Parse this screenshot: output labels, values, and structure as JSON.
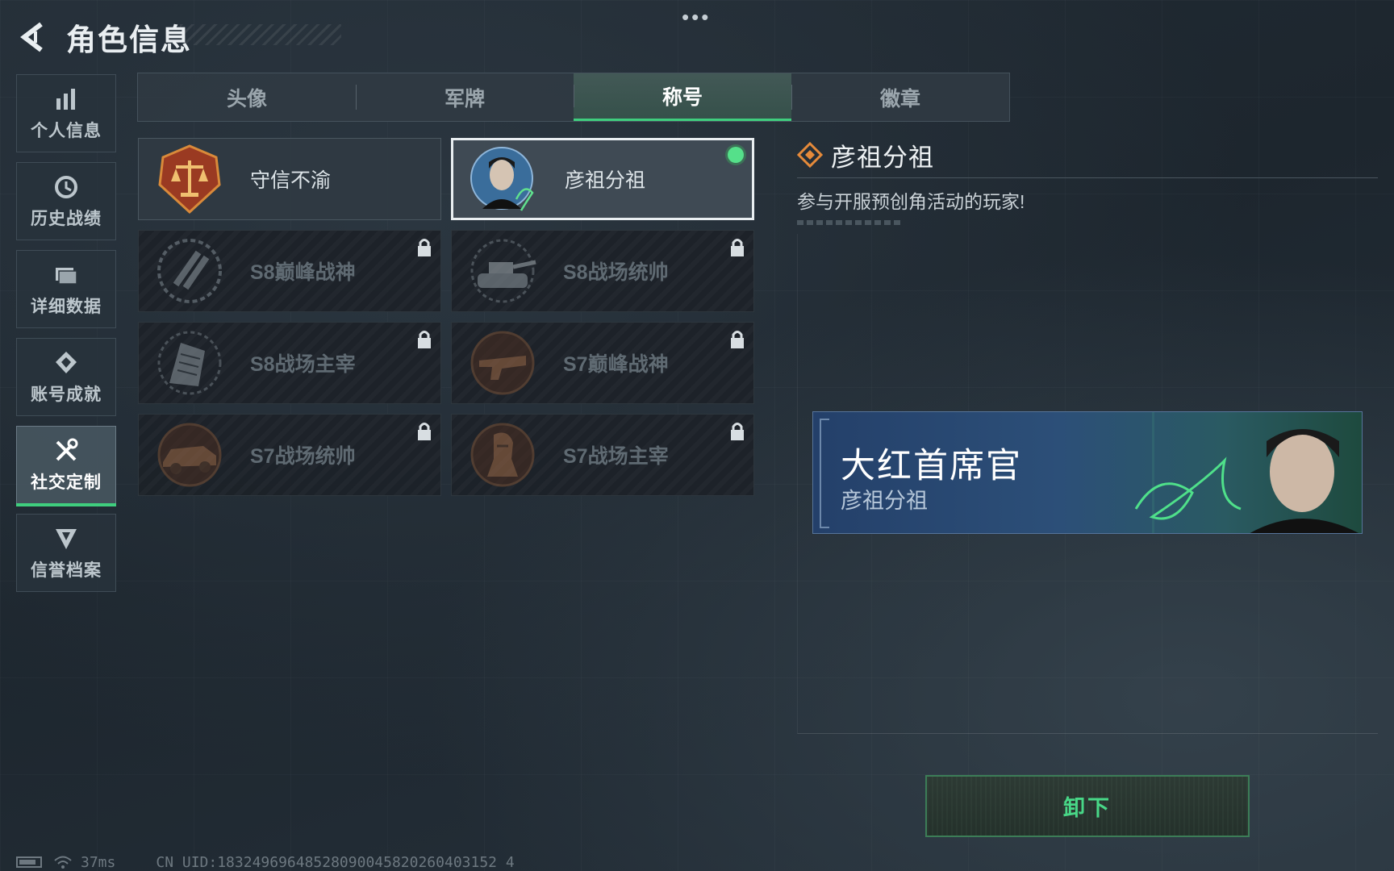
{
  "header": {
    "title": "角色信息",
    "more_label": "•••"
  },
  "sidebar": {
    "items": [
      {
        "label": "个人信息",
        "icon": "bar-chart-icon",
        "active": false
      },
      {
        "label": "历史战绩",
        "icon": "history-clock-icon",
        "active": false
      },
      {
        "label": "详细数据",
        "icon": "folder-icon",
        "active": false
      },
      {
        "label": "账号成就",
        "icon": "medal-icon",
        "active": false
      },
      {
        "label": "社交定制",
        "icon": "tools-icon",
        "active": true
      },
      {
        "label": "信誉档案",
        "icon": "shield-icon",
        "active": false
      }
    ]
  },
  "tabs": [
    {
      "label": "头像",
      "active": false
    },
    {
      "label": "军牌",
      "active": false
    },
    {
      "label": "称号",
      "active": true
    },
    {
      "label": "徽章",
      "active": false
    }
  ],
  "titles": [
    {
      "name": "守信不渝",
      "locked": false,
      "equipped": false,
      "icon": "scales-emblem-icon"
    },
    {
      "name": "彦祖分祖",
      "locked": false,
      "equipped": true,
      "icon": "portrait-emblem-icon"
    },
    {
      "name": "S8巅峰战神",
      "locked": true,
      "equipped": false,
      "icon": "slash-emblem-icon"
    },
    {
      "name": "S8战场统帅",
      "locked": true,
      "equipped": false,
      "icon": "tank-emblem-icon"
    },
    {
      "name": "S8战场主宰",
      "locked": true,
      "equipped": false,
      "icon": "building-emblem-icon"
    },
    {
      "name": "S7巅峰战神",
      "locked": true,
      "equipped": false,
      "icon": "weapon-emblem-icon"
    },
    {
      "name": "S7战场统帅",
      "locked": true,
      "equipped": false,
      "icon": "vehicle-emblem-icon"
    },
    {
      "name": "S7战场主宰",
      "locked": true,
      "equipped": false,
      "icon": "soldier-emblem-icon"
    }
  ],
  "detail": {
    "title": "彦祖分祖",
    "description": "参与开服预创角活动的玩家!"
  },
  "nameplate": {
    "player_name": "大红首席官",
    "title": "彦祖分祖"
  },
  "unequip_label": "卸下",
  "status": {
    "ping": "37ms",
    "uid": "CN UID:18324969648528090045820260403152 4"
  },
  "colors": {
    "accent_green": "#3fce7e",
    "equipped_dot": "#55e08a",
    "banner_blue": "#2c4f78"
  }
}
